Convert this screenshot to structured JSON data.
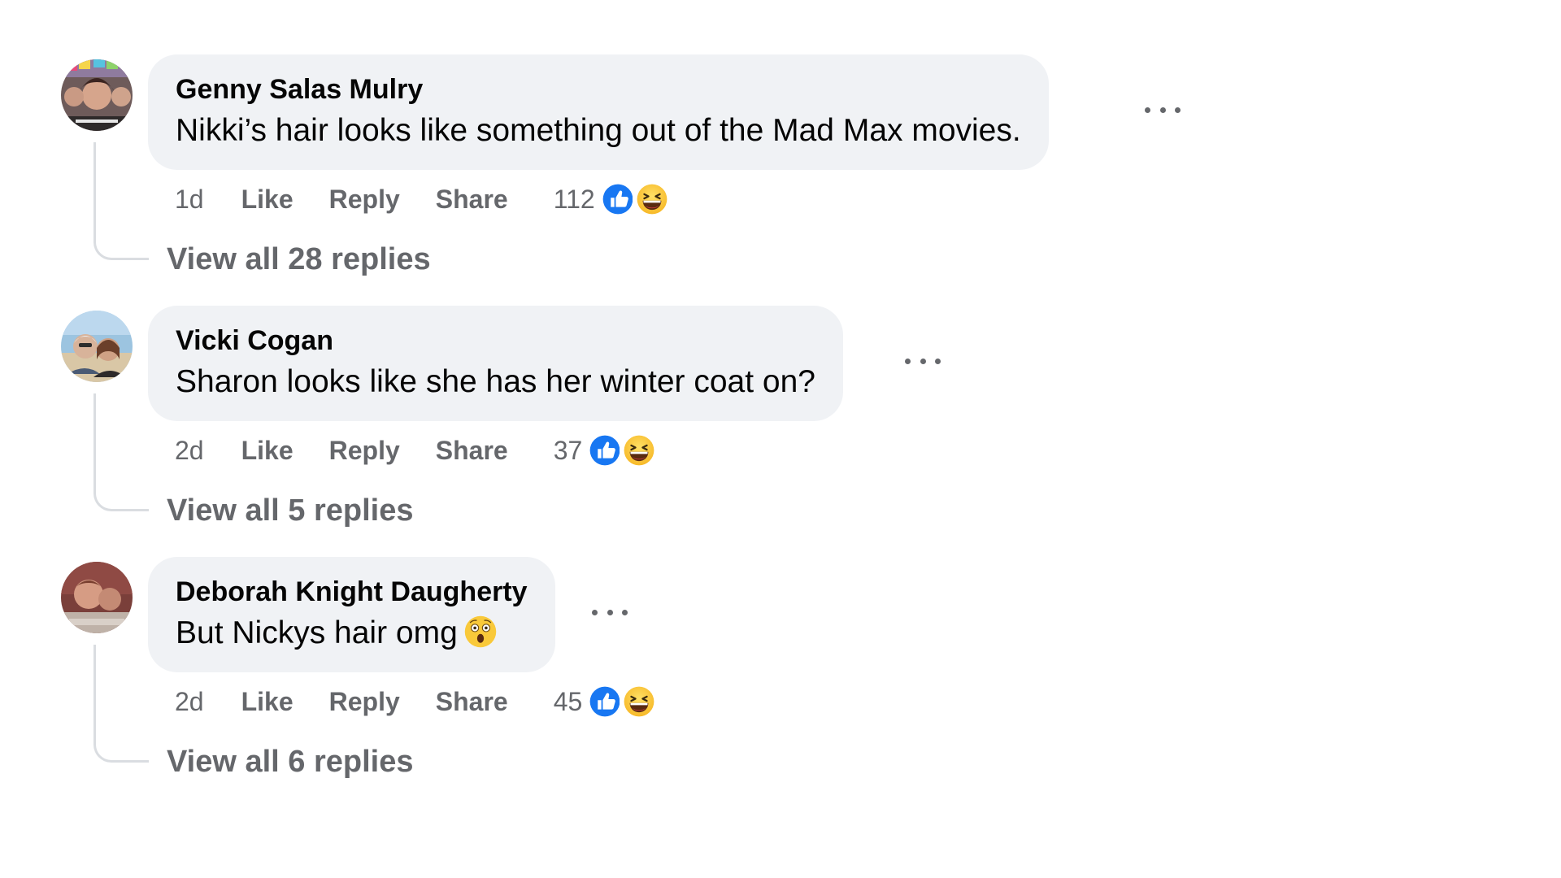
{
  "colors": {
    "bubble_bg": "#f0f2f5",
    "text_primary": "#050505",
    "text_secondary": "#65676b",
    "like_blue": "#1877f2",
    "haha_yellow": "#f7b928",
    "thread_line": "#dadde1"
  },
  "comments": [
    {
      "author": "Genny Salas Mulry",
      "text": "Nikki’s hair looks like something out of the Mad Max movies.",
      "time": "1d",
      "like_label": "Like",
      "reply_label": "Reply",
      "share_label": "Share",
      "reaction_count": "112",
      "reactions": [
        "like-icon",
        "haha-icon"
      ],
      "view_replies": "View all 28 replies",
      "more_icon": "more-options-icon"
    },
    {
      "author": "Vicki Cogan",
      "text": "Sharon looks like she has her winter coat on?",
      "time": "2d",
      "like_label": "Like",
      "reply_label": "Reply",
      "share_label": "Share",
      "reaction_count": "37",
      "reactions": [
        "like-icon",
        "haha-icon"
      ],
      "view_replies": "View all 5 replies",
      "more_icon": "more-options-icon"
    },
    {
      "author": "Deborah Knight Daugherty",
      "text": "But Nickys hair omg",
      "text_emoji": "astonished-face-icon",
      "time": "2d",
      "like_label": "Like",
      "reply_label": "Reply",
      "share_label": "Share",
      "reaction_count": "45",
      "reactions": [
        "like-icon",
        "haha-icon"
      ],
      "view_replies": "View all 6 replies",
      "more_icon": "more-options-icon"
    }
  ]
}
